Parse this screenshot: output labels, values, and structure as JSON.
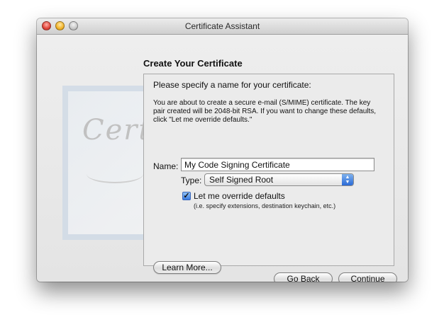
{
  "window": {
    "title": "Certificate Assistant"
  },
  "assistant": {
    "heading": "Create Your Certificate",
    "prompt": "Please specify a name for your certificate:",
    "info": "You are about to create a secure e-mail (S/MIME) certificate. The key pair created will be 2048-bit RSA. If you want to change these defaults, click \"Let me override defaults.\"",
    "name_label": "Name:",
    "name_value": "My Code Signing Certificate",
    "type_label": "Type:",
    "type_value": "Self Signed Root",
    "override_label": "Let me override defaults",
    "override_checked": true,
    "override_hint": "(i.e. specify extensions, destination keychain, etc.)",
    "learn_more_label": "Learn More..."
  },
  "footer": {
    "go_back_label": "Go Back",
    "continue_label": "Continue"
  },
  "decor": {
    "certificate_script": "Certif",
    "select_arrows_icon": "up-down-arrows",
    "checkmark_icon": "checkmark"
  }
}
